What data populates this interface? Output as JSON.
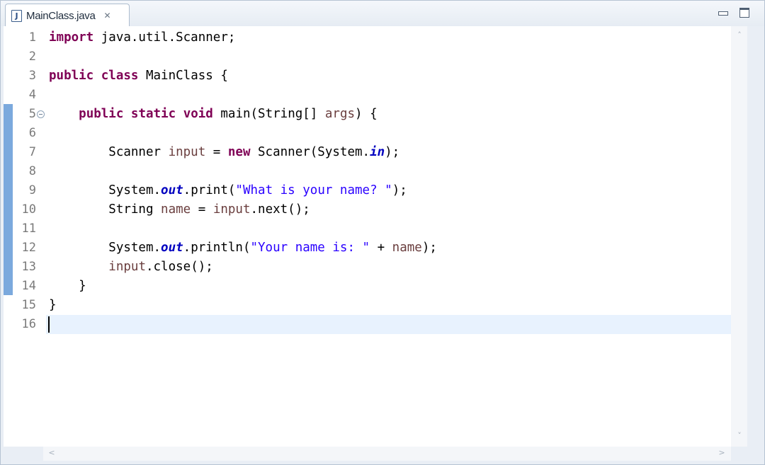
{
  "tab": {
    "file_icon_letter": "J",
    "title": "MainClass.java",
    "close_glyph": "✕"
  },
  "window_controls": [
    "minimize-icon",
    "maximize-icon"
  ],
  "line_numbers": [
    "1",
    "2",
    "3",
    "4",
    "5",
    "6",
    "7",
    "8",
    "9",
    "10",
    "11",
    "12",
    "13",
    "14",
    "15",
    "16"
  ],
  "code_lines": [
    [
      {
        "t": "import",
        "c": "kw"
      },
      {
        "t": " java.util.Scanner;"
      }
    ],
    [],
    [
      {
        "t": "public",
        "c": "kw"
      },
      {
        "t": " "
      },
      {
        "t": "class",
        "c": "kw"
      },
      {
        "t": " MainClass {"
      }
    ],
    [],
    [
      {
        "t": "    "
      },
      {
        "t": "public",
        "c": "kw"
      },
      {
        "t": " "
      },
      {
        "t": "static",
        "c": "kw"
      },
      {
        "t": " "
      },
      {
        "t": "void",
        "c": "kw"
      },
      {
        "t": " main(String[] "
      },
      {
        "t": "args",
        "c": "var"
      },
      {
        "t": ") {"
      }
    ],
    [],
    [
      {
        "t": "        Scanner "
      },
      {
        "t": "input",
        "c": "var"
      },
      {
        "t": " = "
      },
      {
        "t": "new",
        "c": "kw"
      },
      {
        "t": " Scanner(System."
      },
      {
        "t": "in",
        "c": "fld"
      },
      {
        "t": ");"
      }
    ],
    [],
    [
      {
        "t": "        System."
      },
      {
        "t": "out",
        "c": "fld"
      },
      {
        "t": ".print("
      },
      {
        "t": "\"What is your name? \"",
        "c": "str"
      },
      {
        "t": ");"
      }
    ],
    [
      {
        "t": "        String "
      },
      {
        "t": "name",
        "c": "var"
      },
      {
        "t": " = "
      },
      {
        "t": "input",
        "c": "var"
      },
      {
        "t": ".next();"
      }
    ],
    [],
    [
      {
        "t": "        System."
      },
      {
        "t": "out",
        "c": "fld"
      },
      {
        "t": ".println("
      },
      {
        "t": "\"Your name is: \"",
        "c": "str"
      },
      {
        "t": " + "
      },
      {
        "t": "name",
        "c": "var"
      },
      {
        "t": ");"
      }
    ],
    [
      {
        "t": "        "
      },
      {
        "t": "input",
        "c": "var"
      },
      {
        "t": ".close();"
      }
    ],
    [
      {
        "t": "    }"
      }
    ],
    [
      {
        "t": "}"
      }
    ],
    []
  ],
  "scroll": {
    "up_glyph": "˄",
    "down_glyph": "˅",
    "left_glyph": "<",
    "right_glyph": ">"
  }
}
